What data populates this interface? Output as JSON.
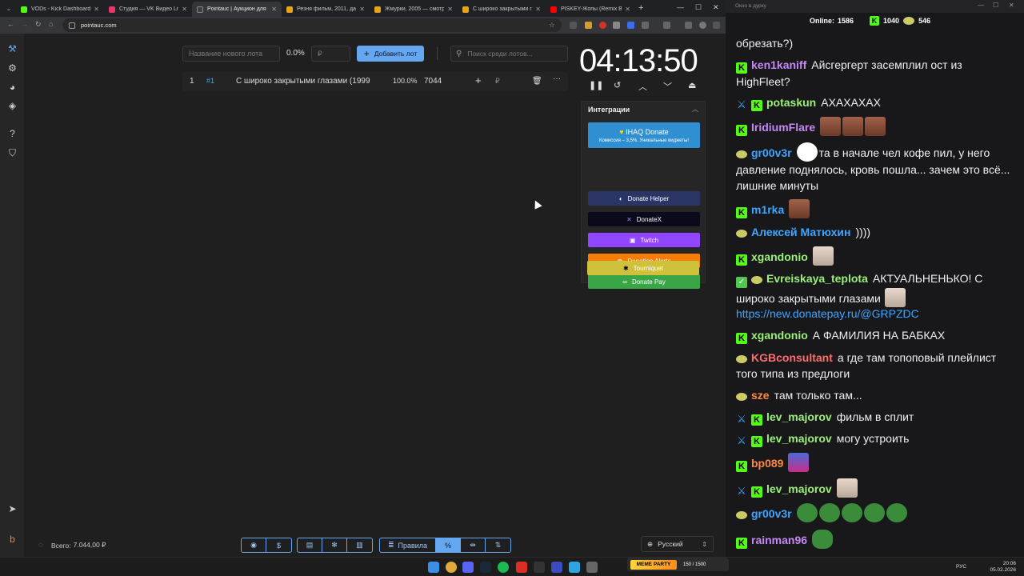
{
  "browser": {
    "tabs": [
      {
        "title": "VODs - Kick Dashboard",
        "color": "#53fc18",
        "active": false
      },
      {
        "title": "Студия — VK Видео Live",
        "color": "#e8356d",
        "active": false
      },
      {
        "title": "Pointauc | Аукцион для стр…",
        "color": "#3f3f3f",
        "active": true
      },
      {
        "title": "Резня фильм, 2011, дата вы…",
        "color": "#e8a317",
        "active": false
      },
      {
        "title": "Жмурки, 2005 — смотреть…",
        "color": "#e8a317",
        "active": false
      },
      {
        "title": "С широко закрытыми глаз…",
        "color": "#e8a317",
        "active": false
      },
      {
        "title": "PISKEY-Жопы (Remix BSWI…",
        "color": "#ff0000",
        "active": false
      }
    ],
    "url": "pointauc.com"
  },
  "auction": {
    "lot_name_placeholder": "Название нового лота",
    "percent": "0.0%",
    "amount_placeholder": "₽",
    "add_button": "Добавить лот",
    "search_placeholder": "Поиск среди лотов...",
    "lot": {
      "index": "1",
      "id": "#1",
      "name": "С широко закрытыми глазами (1999",
      "percent": "100.0%",
      "amount": "7044",
      "currency": "₽"
    },
    "timer": "04:13:50",
    "total_label": "Всего:",
    "total_value": "7.044,00 ₽",
    "rules_label": "Правила",
    "language": "Русский"
  },
  "integrations": {
    "title": "Интеграции",
    "ihaq": {
      "label": "IHAQ Donate",
      "sub": "Комиссия – 3,5%. Уникальные виджеты!"
    },
    "buttons": [
      {
        "label": "Donate Helper",
        "color": "#2a3566"
      },
      {
        "label": "DonateX",
        "color": "#0b0a1a"
      },
      {
        "label": "Twitch",
        "color": "#9147ff"
      },
      {
        "label": "Donation Alerts",
        "color": "#f57d07"
      },
      {
        "label": "Donate Pay",
        "color": "#3aa547"
      },
      {
        "label": "Tourniquet",
        "color": "#cfc13a"
      }
    ]
  },
  "chat": {
    "window_title": "Окно в дурку",
    "online_label": "Online:",
    "online_value": "1586",
    "stat1": "1040",
    "stat2": "546",
    "messages": [
      {
        "user": "ken1kaniff",
        "user_color": "#c688f5",
        "text": "Айсгергерт засемплил ост из HighFleet?"
      },
      {
        "user": "potaskun",
        "user_color": "#9cf078",
        "text": "АХАХАХАХ"
      },
      {
        "user": "IridiumFlare",
        "user_color": "#c688f5",
        "text": ""
      },
      {
        "user": "gr00v3r",
        "user_color": "#3ea6ff",
        "text": "та в начале чел кофе пил, у него давление поднялось, кровь пошла... зачем это всё... лишние минуты"
      },
      {
        "user": "m1rka",
        "user_color": "#3ea6ff",
        "text": ""
      },
      {
        "user": "Алексей Матюхин",
        "user_color": "#3ea6ff",
        "text": "))))"
      },
      {
        "user": "xgandonio",
        "user_color": "#9cf078",
        "text": ""
      },
      {
        "user": "Evreiskaya_teplota",
        "user_color": "#9cf078",
        "text": "АКТУАЛЬНЕНЬКО! С широко закрытыми глазами"
      },
      {
        "user": "",
        "user_color": "#3ea6ff",
        "text": "https://new.donatepay.ru/@GRPZDC"
      },
      {
        "user": "xgandonio",
        "user_color": "#9cf078",
        "text": "А ФАМИЛИЯ НА БАБКАХ"
      },
      {
        "user": "KGBconsultant",
        "user_color": "#ff6e6e",
        "text": "а где там топоповый плейлист того типа из предлоги"
      },
      {
        "user": "sze",
        "user_color": "#ff8a3d",
        "text": "там только там..."
      },
      {
        "user": "lev_majorov",
        "user_color": "#9cf078",
        "text": "фильм в сплит"
      },
      {
        "user": "lev_majorov",
        "user_color": "#9cf078",
        "text": "могу устроить"
      },
      {
        "user": "bp089",
        "user_color": "#ff8a3d",
        "text": ""
      },
      {
        "user": "lev_majorov",
        "user_color": "#9cf078",
        "text": ""
      },
      {
        "user": "gr00v3r",
        "user_color": "#3ea6ff",
        "text": ""
      },
      {
        "user": "rainman96",
        "user_color": "#c688f5",
        "text": ""
      }
    ],
    "partial_top": "обрезать?)"
  },
  "taskbar": {
    "lang": "РУС",
    "time": "20:06",
    "date": "05.02.2026",
    "media_title": "МЕМЕ PARTY",
    "media_count": "150 / 1500"
  }
}
